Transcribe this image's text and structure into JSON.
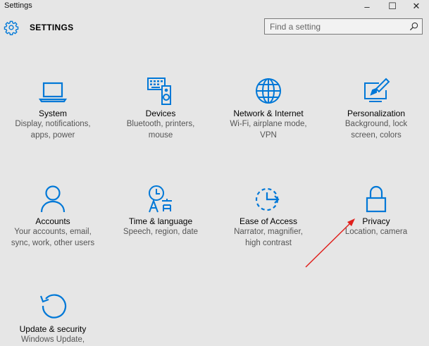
{
  "window": {
    "title": "Settings",
    "minimize_glyph": "–",
    "maximize_glyph": "☐",
    "close_glyph": "✕"
  },
  "header": {
    "heading": "SETTINGS",
    "icon": "gear-icon"
  },
  "search": {
    "placeholder": "Find a setting",
    "value": "",
    "icon": "search-icon"
  },
  "accent_color": "#0078d7",
  "tiles": [
    {
      "name": "System",
      "desc_lines": [
        "Display, notifications,",
        "apps, power"
      ],
      "icon": "laptop-icon"
    },
    {
      "name": "Devices",
      "desc_lines": [
        "Bluetooth, printers,",
        "mouse"
      ],
      "icon": "devices-icon"
    },
    {
      "name": "Network & Internet",
      "desc_lines": [
        "Wi-Fi, airplane mode,",
        "VPN"
      ],
      "icon": "globe-icon"
    },
    {
      "name": "Personalization",
      "desc_lines": [
        "Background, lock",
        "screen, colors"
      ],
      "icon": "paintbrush-icon"
    },
    {
      "name": "Accounts",
      "desc_lines": [
        "Your accounts, email,",
        "sync, work, other users"
      ],
      "icon": "person-icon"
    },
    {
      "name": "Time & language",
      "desc_lines": [
        "Speech, region, date"
      ],
      "icon": "time-language-icon"
    },
    {
      "name": "Ease of Access",
      "desc_lines": [
        "Narrator, magnifier,",
        "high contrast"
      ],
      "icon": "ease-of-access-icon"
    },
    {
      "name": "Privacy",
      "desc_lines": [
        "Location, camera"
      ],
      "icon": "lock-icon"
    },
    {
      "name": "Update & security",
      "desc_lines": [
        "Windows Update,"
      ],
      "icon": "refresh-icon"
    }
  ],
  "annotation": {
    "type": "red-arrow",
    "color": "#e0201c",
    "target": "Privacy"
  }
}
